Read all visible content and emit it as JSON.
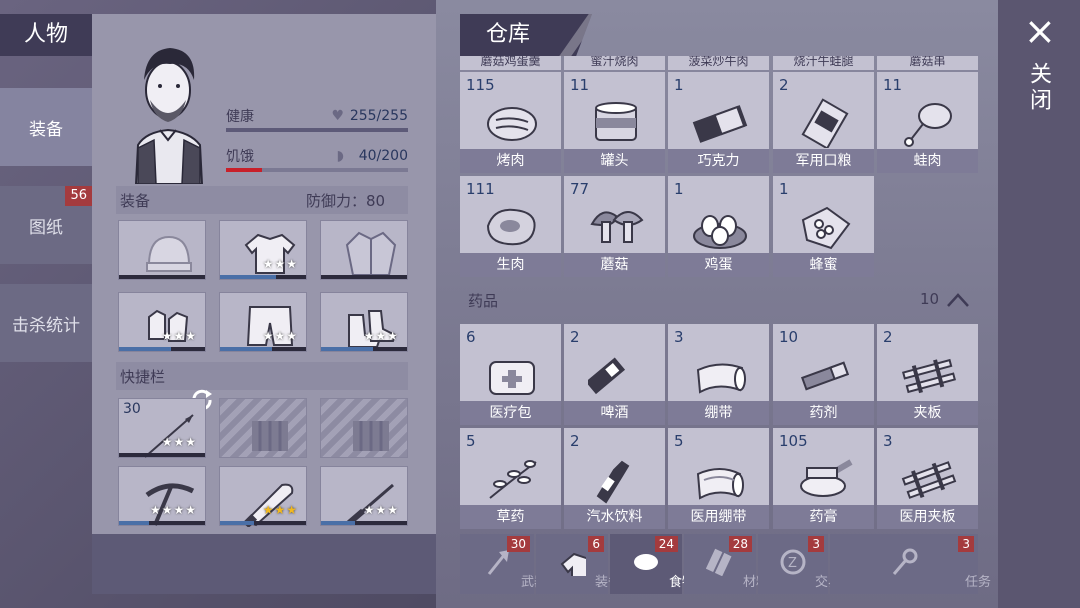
{
  "header": {
    "person_title": "人物",
    "store_title": "仓库",
    "close_label": "关闭",
    "close_icon": "×"
  },
  "sidebar": {
    "items": [
      {
        "label": "装备",
        "badge": ""
      },
      {
        "label": "图纸",
        "badge": "56"
      },
      {
        "label": "击杀统计",
        "badge": ""
      }
    ]
  },
  "character": {
    "health_label": "健康",
    "health_value": "255/255",
    "health_fill": 1.0,
    "hunger_label": "饥饿",
    "hunger_value": "40/200",
    "hunger_fill": 0.2,
    "equip_label": "装备",
    "defense_label": "防御力：80",
    "quickbar_label": "快捷栏",
    "equip_slots": [
      {
        "icon": "beanie-icon",
        "stars": "",
        "fill": 0
      },
      {
        "icon": "shirt-icon",
        "stars": "★★★",
        "fill": 0.65
      },
      {
        "icon": "jacket-icon",
        "stars": "",
        "fill": 0
      },
      {
        "icon": "gloves-icon",
        "stars": "★★★",
        "fill": 0.6
      },
      {
        "icon": "shorts-icon",
        "stars": "★★★",
        "fill": 0.6
      },
      {
        "icon": "boots-icon",
        "stars": "★★★",
        "fill": 0.6
      }
    ],
    "quick_slots": [
      {
        "icon": "spear-icon",
        "count": "30",
        "stars": "★★★",
        "gold": false,
        "locked": false,
        "fill": 0
      },
      {
        "icon": "locked-slot",
        "count": "",
        "stars": "",
        "gold": false,
        "locked": true,
        "fill": 0
      },
      {
        "icon": "locked-slot",
        "count": "",
        "stars": "",
        "gold": false,
        "locked": true,
        "fill": 0
      },
      {
        "icon": "pickaxe-icon",
        "count": "",
        "stars": "★★★★",
        "gold": false,
        "locked": false,
        "fill": 0.35
      },
      {
        "icon": "machete-icon",
        "count": "",
        "stars": "★★★",
        "gold": true,
        "locked": false,
        "fill": 0.4
      },
      {
        "icon": "knife-icon",
        "count": "",
        "stars": "★★★",
        "gold": false,
        "locked": false,
        "fill": 0.4
      }
    ]
  },
  "warehouse": {
    "top_partial": [
      "蘑菇鸡蛋羹",
      "蜜汁烧肉",
      "菠菜炒牛肉",
      "烧汁牛蛙腿",
      "蘑菇串"
    ],
    "food": [
      {
        "count": "115",
        "name": "烤肉",
        "icon": "roast-meat-icon"
      },
      {
        "count": "11",
        "name": "罐头",
        "icon": "canned-food-icon"
      },
      {
        "count": "1",
        "name": "巧克力",
        "icon": "chocolate-icon"
      },
      {
        "count": "2",
        "name": "军用口粮",
        "icon": "ration-icon"
      },
      {
        "count": "11",
        "name": "蛙肉",
        "icon": "frog-meat-icon"
      },
      {
        "count": "111",
        "name": "生肉",
        "icon": "raw-meat-icon"
      },
      {
        "count": "77",
        "name": "蘑菇",
        "icon": "mushroom-icon"
      },
      {
        "count": "1",
        "name": "鸡蛋",
        "icon": "eggs-icon"
      },
      {
        "count": "1",
        "name": "蜂蜜",
        "icon": "honey-icon"
      }
    ],
    "medicine_label": "药品",
    "medicine_count": "10",
    "medicine": [
      {
        "count": "6",
        "name": "医疗包",
        "icon": "medkit-icon"
      },
      {
        "count": "2",
        "name": "啤酒",
        "icon": "beer-icon"
      },
      {
        "count": "3",
        "name": "绷带",
        "icon": "bandage-icon"
      },
      {
        "count": "10",
        "name": "药剂",
        "icon": "injector-icon"
      },
      {
        "count": "2",
        "name": "夹板",
        "icon": "splint-icon"
      },
      {
        "count": "5",
        "name": "草药",
        "icon": "herb-icon"
      },
      {
        "count": "2",
        "name": "汽水饮料",
        "icon": "soda-icon"
      },
      {
        "count": "5",
        "name": "医用绷带",
        "icon": "medical-bandage-icon"
      },
      {
        "count": "105",
        "name": "药膏",
        "icon": "ointment-icon"
      },
      {
        "count": "3",
        "name": "医用夹板",
        "icon": "medical-splint-icon"
      }
    ]
  },
  "categories": [
    {
      "label": "武器",
      "count": "30",
      "icon": "axe-icon",
      "active": false
    },
    {
      "label": "装备",
      "count": "6",
      "icon": "shirt-icon",
      "active": false
    },
    {
      "label": "食物",
      "count": "24",
      "icon": "meat-icon",
      "active": true
    },
    {
      "label": "材料",
      "count": "28",
      "icon": "wood-icon",
      "active": false
    },
    {
      "label": "交易",
      "count": "3",
      "icon": "coin-icon",
      "active": false
    },
    {
      "label": "任务",
      "count": "3",
      "icon": "key-icon",
      "active": false
    }
  ]
}
